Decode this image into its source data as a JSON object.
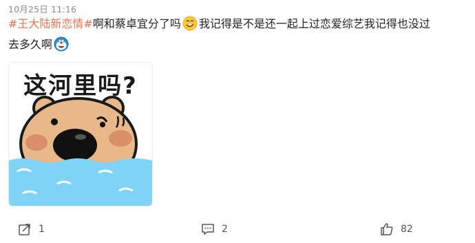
{
  "post": {
    "timestamp": "10月25日 11:16",
    "hashtag": "#王大陆新恋情#",
    "text_line1": "啊和蔡卓宜分了吗",
    "text_line1b": "我记得是不是还一起上过恋爱综艺我记得也没过",
    "text_line2": "去多久啊",
    "emoji1": "grinning-smirk-emoji",
    "emoji2": "doraemon-emoji"
  },
  "sticker": {
    "caption": "这河里吗?",
    "icon": "bear-in-water-sticker"
  },
  "actions": {
    "repost_count": "1",
    "comment_count": "2",
    "like_count": "82"
  },
  "colors": {
    "hashtag": "#eb7350",
    "text": "#222222",
    "meta": "#8a8a8a",
    "water": "#7ed3f7",
    "bear": "#e8b888"
  }
}
